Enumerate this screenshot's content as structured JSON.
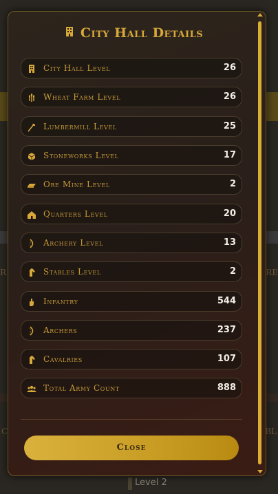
{
  "background": {
    "left_text": "R",
    "right_text": "RE",
    "left_text2": "C",
    "right_text2": "BL",
    "level_label": "Level 2"
  },
  "modal": {
    "title": "City Hall Details",
    "title_icon": "building-icon",
    "rows": [
      {
        "icon": "building-icon",
        "label": "City Hall Level",
        "value": "26"
      },
      {
        "icon": "wheat-icon",
        "label": "Wheat Farm Level",
        "value": "26"
      },
      {
        "icon": "axe-icon",
        "label": "Lumbermill Level",
        "value": "25"
      },
      {
        "icon": "stone-icon",
        "label": "Stoneworks Level",
        "value": "17"
      },
      {
        "icon": "ore-icon",
        "label": "Ore Mine Level",
        "value": "2"
      },
      {
        "icon": "house-icon",
        "label": "Quarters Level",
        "value": "20"
      },
      {
        "icon": "bow-icon",
        "label": "Archery Level",
        "value": "13"
      },
      {
        "icon": "horse-icon",
        "label": "Stables Level",
        "value": "2"
      },
      {
        "icon": "fist-icon",
        "label": "Infantry",
        "value": "544"
      },
      {
        "icon": "bow-icon",
        "label": "Archers",
        "value": "237"
      },
      {
        "icon": "horse-icon",
        "label": "Cavalries",
        "value": "107"
      },
      {
        "icon": "users-icon",
        "label": "Total Army Count",
        "value": "888"
      }
    ],
    "close_label": "Close"
  },
  "colors": {
    "accent_gold": "#d7a83a",
    "label_gold": "#c69a3a",
    "value_white": "#f2eee6"
  }
}
